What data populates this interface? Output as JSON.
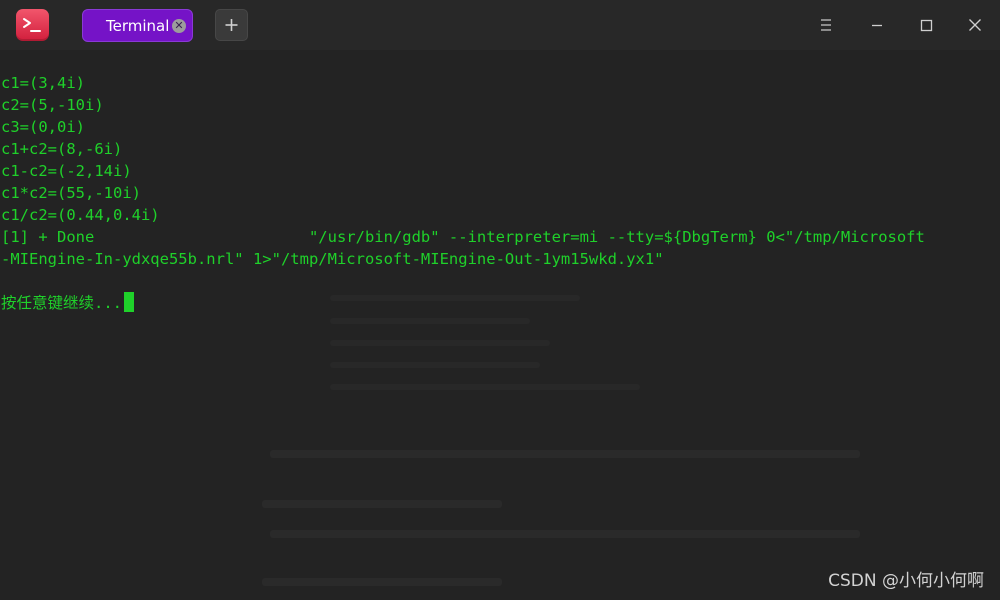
{
  "window": {
    "app_icon": "terminal-app-icon",
    "tab": {
      "label": "Terminal",
      "close_icon": "close-icon"
    },
    "new_tab_icon": "plus-icon",
    "controls": [
      "menu-icon",
      "minimize-icon",
      "maximize-icon",
      "close-icon"
    ]
  },
  "terminal": {
    "lines": [
      "c1=(3,4i)",
      "c2=(5,-10i)",
      "c3=(0,0i)",
      "c1+c2=(8,-6i)",
      "c1-c2=(-2,14i)",
      "c1*c2=(55,-10i)",
      "c1/c2=(0.44,0.4i)",
      "[1] + Done                       \"/usr/bin/gdb\" --interpreter=mi --tty=${DbgTerm} 0<\"/tmp/Microsoft",
      "-MIEngine-In-ydxqe55b.nrl\" 1>\"/tmp/Microsoft-MIEngine-Out-1ym15wkd.yx1\"",
      "",
      "按任意键继续..."
    ],
    "text_color": "#1fd12a",
    "background_color": "#232323"
  },
  "watermark": "CSDN @小何小何啊",
  "colors": {
    "tab_active": "#7513c7",
    "titlebar": "#282828",
    "app_icon": "#e03350"
  }
}
